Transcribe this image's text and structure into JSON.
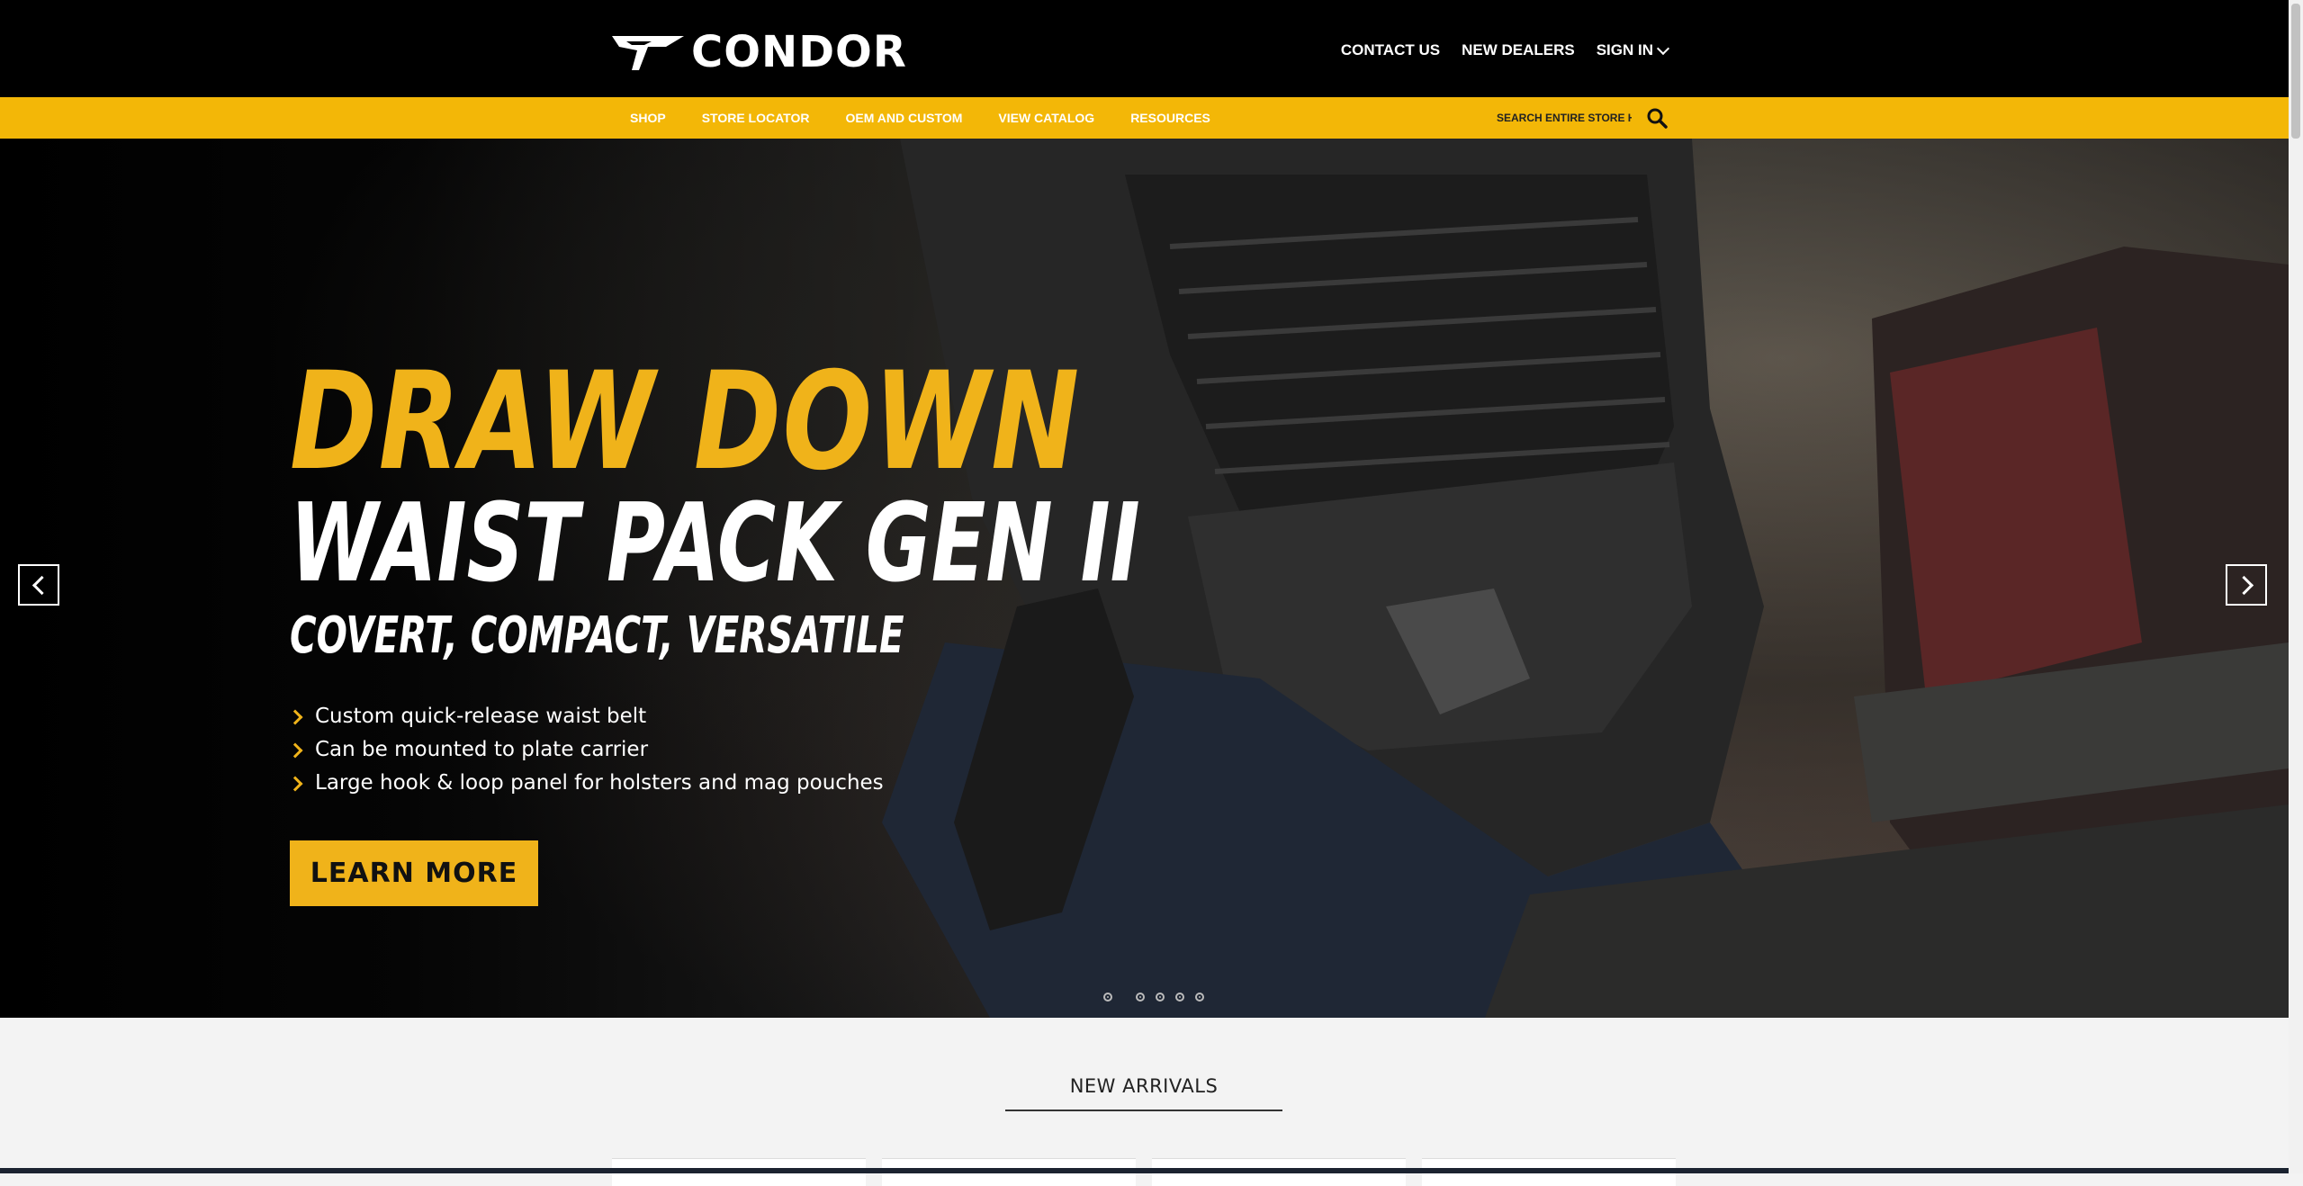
{
  "header": {
    "logo_text": "CONDOR",
    "links": {
      "contact": "CONTACT US",
      "dealers": "NEW DEALERS",
      "signin": "SIGN IN"
    }
  },
  "nav": {
    "items": [
      "SHOP",
      "STORE LOCATOR",
      "OEM AND CUSTOM",
      "VIEW CATALOG",
      "RESOURCES"
    ],
    "search_placeholder": "SEARCH ENTIRE STORE HERE..."
  },
  "hero": {
    "line1": "DRAW DOWN",
    "line2": "WAIST PACK GEN II",
    "line3": "COVERT, COMPACT, VERSATILE",
    "bullets": [
      "Custom quick-release waist belt",
      "Can be mounted to plate carrier",
      "Large hook & loop panel for holsters and mag pouches"
    ],
    "cta": "LEARN MORE",
    "slide_count": 5
  },
  "sections": {
    "new_arrivals_title": "NEW ARRIVALS"
  },
  "colors": {
    "brand_yellow": "#f3b707",
    "hero_yellow": "#f0b31a",
    "header_bg": "#000000"
  },
  "icons": {
    "search": "search-icon",
    "prev": "chevron-left-icon",
    "next": "chevron-right-icon",
    "signin_caret": "chevron-down-icon",
    "logo_mark": "condor-bird-icon"
  }
}
